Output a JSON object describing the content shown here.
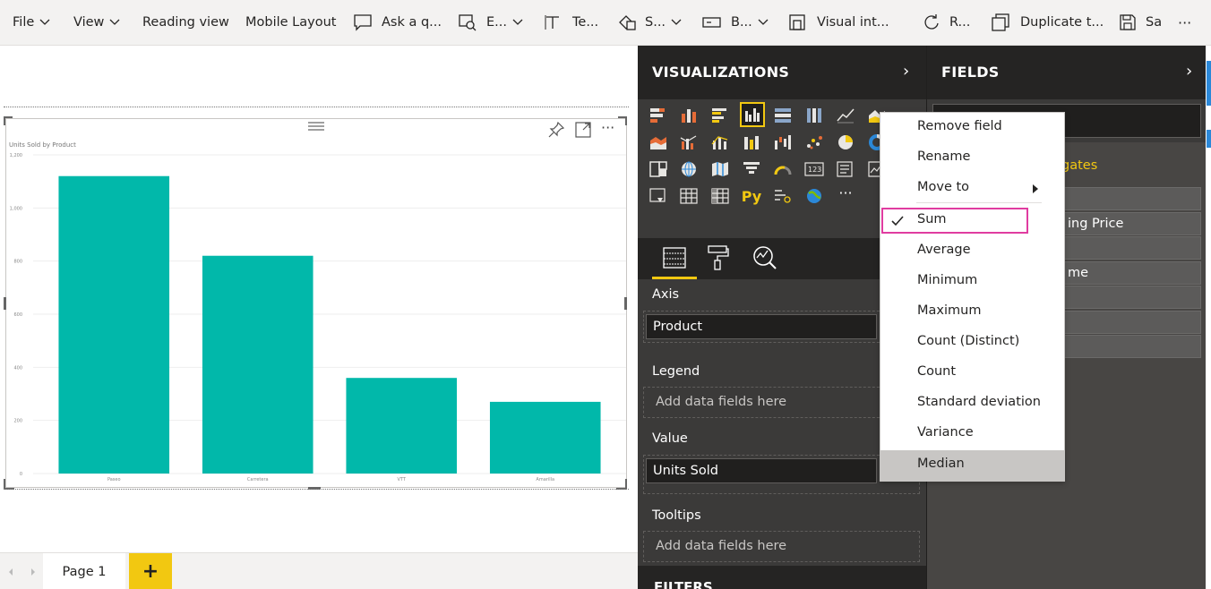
{
  "toolbar": {
    "file": "File",
    "view": "View",
    "reading_view": "Reading view",
    "mobile_layout": "Mobile Layout",
    "ask": "Ask a q...",
    "explore": "E...",
    "text": "Te...",
    "shapes": "S...",
    "buttons": "B...",
    "visual_interactions": "Visual int...",
    "refresh": "R...",
    "duplicate": "Duplicate t...",
    "save": "Sa",
    "more": "···"
  },
  "canvas": {
    "visual": {
      "more": "···"
    }
  },
  "chart_data": {
    "type": "bar",
    "title": "Units Sold by Product",
    "categories": [
      "Paseo",
      "Carretera",
      "VTT",
      "Amarilla"
    ],
    "values": [
      1120,
      820,
      360,
      270
    ],
    "ylim": [
      0,
      1200
    ],
    "yticks": [
      0,
      200,
      400,
      600,
      800,
      1000,
      1200
    ],
    "ytick_labels": [
      "0",
      "200",
      "400",
      "600",
      "800",
      "1,000",
      "1,200"
    ],
    "bar_color": "#01b8aa",
    "grid": true
  },
  "pages": {
    "tab": "Page 1",
    "add": "+"
  },
  "visualizations": {
    "title": "VISUALIZATIONS",
    "collapse": "›",
    "python_label": "Py",
    "more_visuals": "···",
    "wells": {
      "axis_label": "Axis",
      "axis_value": "Product",
      "legend_label": "Legend",
      "legend_placeholder": "Add data fields here",
      "value_label": "Value",
      "value_value": "Units Sold",
      "tooltips_label": "Tooltips",
      "tooltips_placeholder": "Add data fields here"
    },
    "filters_label": "FILTERS"
  },
  "fields": {
    "title": "FIELDS",
    "collapse": "›",
    "group_partial": "gates",
    "items_partial": [
      "",
      "ing Price",
      "",
      "me",
      "",
      "",
      ""
    ]
  },
  "context_menu": {
    "items": [
      "Remove field",
      "Rename",
      "Move to",
      "Sum",
      "Average",
      "Minimum",
      "Maximum",
      "Count (Distinct)",
      "Count",
      "Standard deviation",
      "Variance",
      "Median"
    ],
    "checked": "Sum",
    "highlighted": "Median",
    "outline_color": "#e03ca0"
  },
  "colors": {
    "accent_yellow": "#f2c811",
    "pane_dark": "#3b3a39",
    "header_dark": "#252423",
    "bar": "#01b8aa"
  }
}
